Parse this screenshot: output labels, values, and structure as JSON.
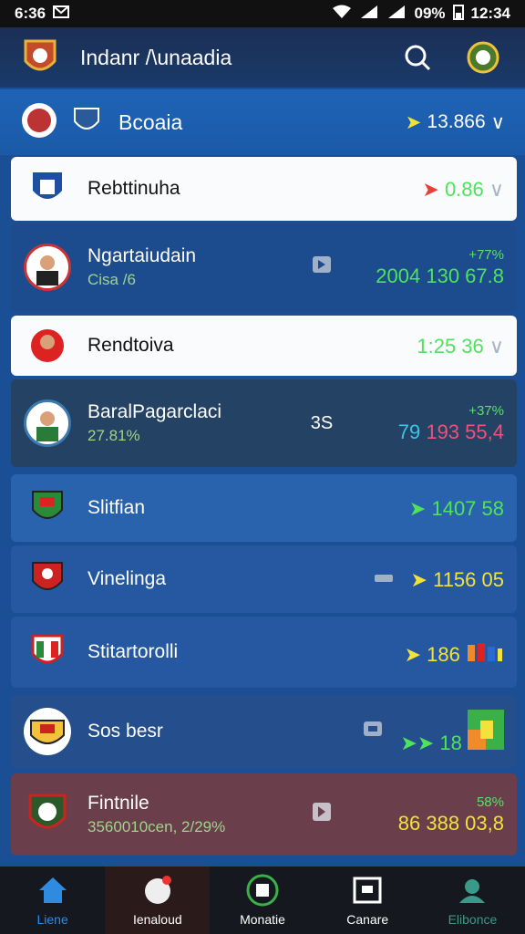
{
  "status": {
    "time_left": "6:36",
    "battery": "09%",
    "time_right": "12:34"
  },
  "app": {
    "title": "Indanr /\\unaadia"
  },
  "header": {
    "name": "Bcoaia",
    "value": "13.866",
    "chevron": "∨"
  },
  "rows": [
    {
      "name": "Rebttinuha",
      "value": "0.86",
      "style": "white"
    },
    {
      "name": "Ngartaiudain",
      "sub": "Cisa /6",
      "stat_top": "+77%",
      "stat_main": "2004 130 67.8"
    },
    {
      "name": "Rendtoiva",
      "value": "1:25 36",
      "style": "white"
    },
    {
      "name": "BaralPagarclaci",
      "sub": "27.81%",
      "mid": "3S",
      "stat_top": "+37%",
      "stat_main_a": "79",
      "stat_main_b": "193",
      "stat_main_c": "55,4"
    },
    {
      "name": "Slitfian",
      "value": "1407 58"
    },
    {
      "name": "Vinelinga",
      "value": "1156 05"
    },
    {
      "name": "Stitartorolli",
      "value": "186"
    },
    {
      "name": "Sos besr",
      "value": "18"
    },
    {
      "name": "Fintnile",
      "sub": "3560010cen, 2/29%",
      "stat_top": "58%",
      "stat_main": "86 388 03,8"
    }
  ],
  "nav": [
    {
      "label": "Liene",
      "icon": "home-icon"
    },
    {
      "label": "Ienaloud",
      "icon": "notification-icon"
    },
    {
      "label": "Monatie",
      "icon": "match-icon"
    },
    {
      "label": "Canare",
      "icon": "scores-icon"
    },
    {
      "label": "Elibonce",
      "icon": "profile-icon"
    }
  ],
  "colors": {
    "accent": "#1a5aa8",
    "gain": "#4ee35a",
    "highlight": "#f3e23b"
  }
}
